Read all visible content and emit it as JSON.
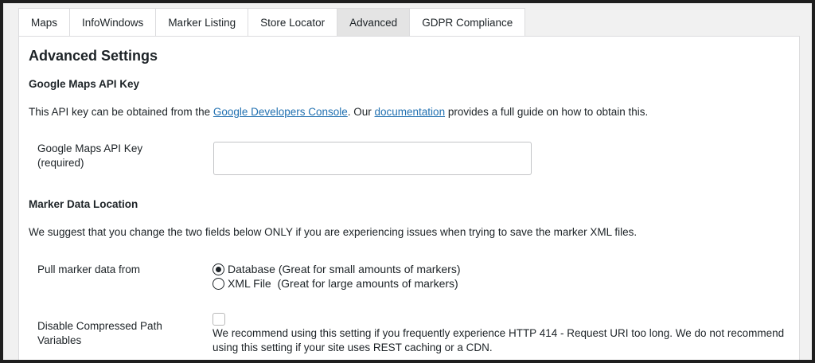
{
  "tabs": [
    {
      "label": "Maps"
    },
    {
      "label": "InfoWindows"
    },
    {
      "label": "Marker Listing"
    },
    {
      "label": "Store Locator"
    },
    {
      "label": "Advanced"
    },
    {
      "label": "GDPR Compliance"
    }
  ],
  "active_tab": "Advanced",
  "page_title": "Advanced Settings",
  "api_key_section": {
    "heading": "Google Maps API Key",
    "info_prefix": "This API key can be obtained from the ",
    "console_link": "Google Developers Console",
    "info_middle": ". Our ",
    "docs_link": "documentation",
    "info_suffix": " provides a full guide on how to obtain this.",
    "field_label_line1": "Google Maps API Key",
    "field_label_line2": "(required)",
    "field_value": ""
  },
  "marker_section": {
    "heading": "Marker Data Location",
    "info": "We suggest that you change the two fields below ONLY if you are experiencing issues when trying to save the marker XML files.",
    "pull_label": "Pull marker data from",
    "options": [
      {
        "label": "Database (Great for small amounts of markers)",
        "selected": true
      },
      {
        "label": "XML File  (Great for large amounts of markers)",
        "selected": false
      }
    ],
    "disable_label_line1": "Disable Compressed Path",
    "disable_label_line2": "Variables",
    "disable_checked": false,
    "disable_description": "We recommend using this setting if you frequently experience HTTP 414 - Request URI too long. We do not recommend using this setting if your site uses REST caching or a CDN."
  }
}
